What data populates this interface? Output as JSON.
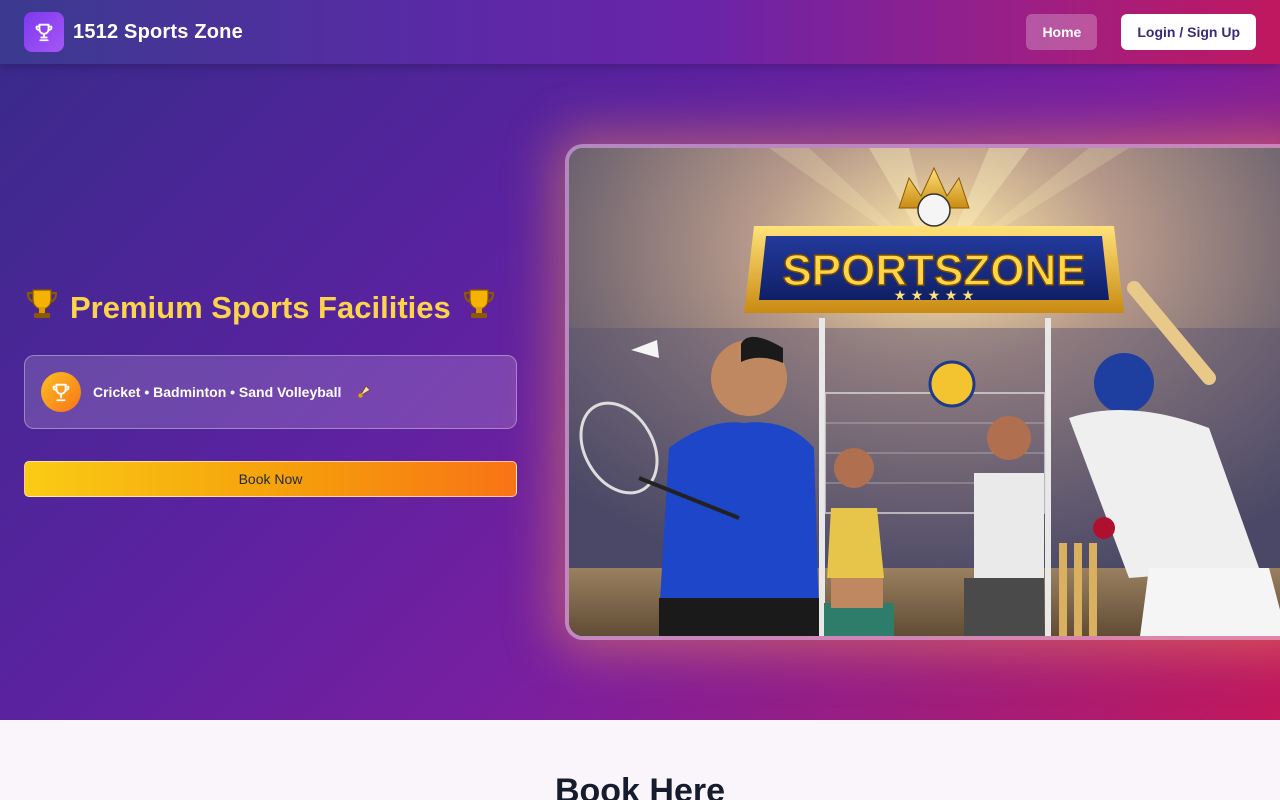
{
  "navbar": {
    "brand_name": "1512 Sports Zone",
    "logo_icon": "trophy-icon",
    "home_label": "Home",
    "login_label": "Login / Sign Up"
  },
  "hero": {
    "title": "Premium Sports Facilities",
    "title_icon": "trophy-icon",
    "feature_text": "Cricket • Badminton • Sand Volleyball",
    "feature_icon": "trophy-icon",
    "feature_emoji": "🏸",
    "book_button_label": "Book Now",
    "image": {
      "banner_text": "SPORTSZONE",
      "description_icon": "sports-collage-image"
    }
  },
  "booking_section": {
    "heading": "Book Here"
  },
  "colors": {
    "accent_yellow": "#fcd34d",
    "brand_purple": "#7c3aed",
    "button_orange": "#f97316",
    "nav_pink": "#c0185f"
  }
}
